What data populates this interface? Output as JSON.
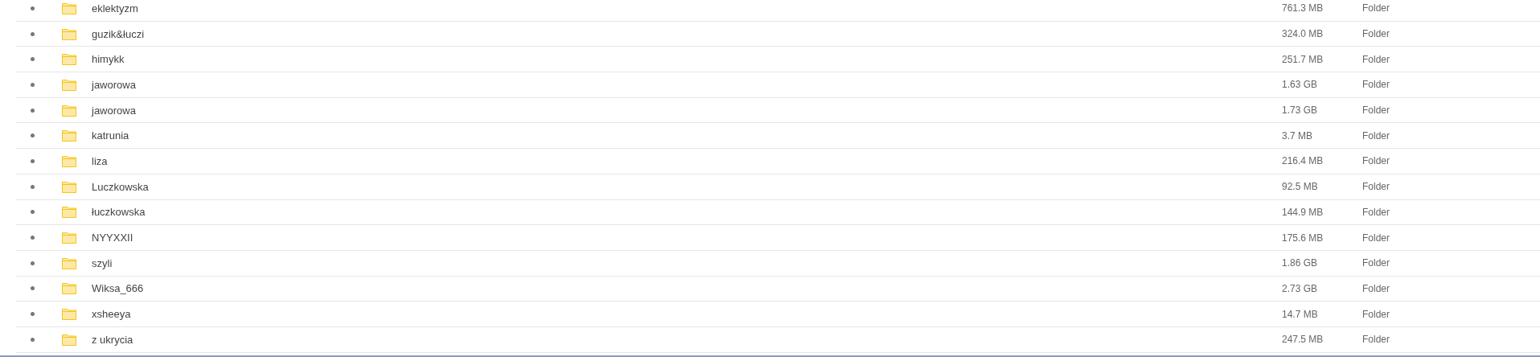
{
  "files": [
    {
      "name": "eklektyzm",
      "size": "761.3 MB",
      "type": "Folder"
    },
    {
      "name": "guzik&łuczi",
      "size": "324.0 MB",
      "type": "Folder"
    },
    {
      "name": "himykk",
      "size": "251.7 MB",
      "type": "Folder"
    },
    {
      "name": "jaworowa",
      "size": "1.63 GB",
      "type": "Folder"
    },
    {
      "name": "jaworowa",
      "size": "1.73 GB",
      "type": "Folder"
    },
    {
      "name": "katrunia",
      "size": "3.7 MB",
      "type": "Folder"
    },
    {
      "name": "liza",
      "size": "216.4 MB",
      "type": "Folder"
    },
    {
      "name": "Luczkowska",
      "size": "92.5 MB",
      "type": "Folder"
    },
    {
      "name": "łuczkowska",
      "size": "144.9 MB",
      "type": "Folder"
    },
    {
      "name": "NYYXXII",
      "size": "175.6 MB",
      "type": "Folder"
    },
    {
      "name": "szyli",
      "size": "1.86 GB",
      "type": "Folder"
    },
    {
      "name": "Wiksa_666",
      "size": "2.73 GB",
      "type": "Folder"
    },
    {
      "name": "xsheeya",
      "size": "14.7 MB",
      "type": "Folder"
    },
    {
      "name": "z ukrycia",
      "size": "247.5 MB",
      "type": "Folder"
    }
  ]
}
